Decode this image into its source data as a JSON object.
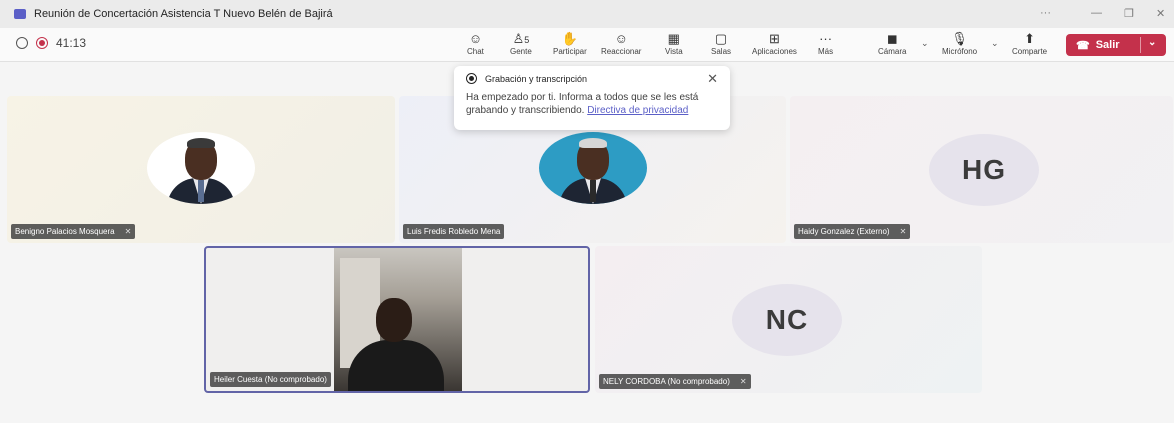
{
  "window": {
    "title": "Reunión de Concertación Asistencia T Nuevo Belén de Bajirá",
    "controls": {
      "more": "···",
      "minimize": "—",
      "restore": "❐",
      "close": "✕"
    }
  },
  "toolbar": {
    "timer": "41:13",
    "buttons": [
      {
        "label": "Chat",
        "icon": "chat-icon",
        "glyph": "☺"
      },
      {
        "label": "Gente",
        "icon": "people-icon",
        "glyph": "♙",
        "count": "5"
      },
      {
        "label": "Participar",
        "icon": "raise-hand-icon",
        "glyph": "✋"
      },
      {
        "label": "Reaccionar",
        "icon": "reaction-icon",
        "glyph": "☺"
      },
      {
        "label": "Vista",
        "icon": "view-icon",
        "glyph": "▦"
      },
      {
        "label": "Salas",
        "icon": "rooms-icon",
        "glyph": "▢"
      },
      {
        "label": "Aplicaciones",
        "icon": "apps-icon",
        "glyph": "⊞"
      },
      {
        "label": "Más",
        "icon": "more-icon",
        "glyph": "···"
      },
      {
        "label": "Cámara",
        "icon": "camera-off-icon",
        "glyph": "◼"
      },
      {
        "label": "Micrófono",
        "icon": "mic-off-icon",
        "glyph": "🎙"
      },
      {
        "label": "Comparte",
        "icon": "share-icon",
        "glyph": "⬆"
      }
    ],
    "leave_label": "Salir",
    "leave_color": "#c4314b"
  },
  "toast": {
    "title": "Grabación y transcripción",
    "body": "Ha empezado por ti. Informa a todos que se les está grabando y transcribiendo.",
    "link": "Directiva de privacidad"
  },
  "participants": [
    {
      "name": "Benigno Palacios Mosquera",
      "muted": true
    },
    {
      "name": "Luis Fredis Robledo Mena",
      "muted": false
    },
    {
      "name": "Haidy Gonzalez (Externo)",
      "initials": "HG",
      "muted": true
    },
    {
      "name": "Heiler Cuesta (No comprobado)",
      "muted": false,
      "video": true
    },
    {
      "name": "NELY CORDOBA (No comprobado)",
      "initials": "NC",
      "muted": true
    }
  ],
  "accent_color": "#6264a7"
}
